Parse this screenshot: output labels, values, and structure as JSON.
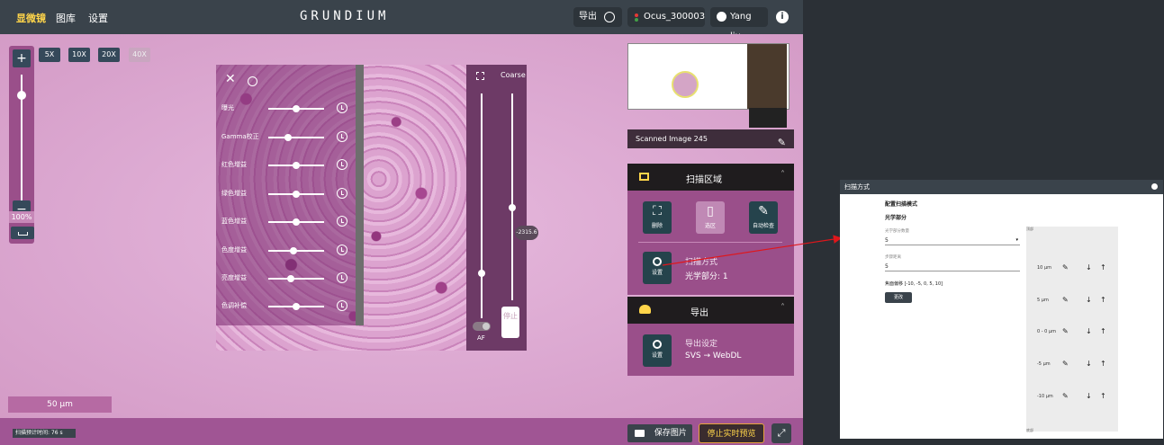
{
  "topbar": {
    "menu": [
      "显微镜",
      "图库",
      "设置"
    ],
    "brand": "GRUNDIUM",
    "export_label": "导出",
    "device_label": "Ocus_300003",
    "user_label": "Yang liu",
    "info_label": "i"
  },
  "zoom": {
    "plus": "+",
    "minus": "−",
    "percent": "100%",
    "level": 0.85
  },
  "magnifications": [
    {
      "label": "5X",
      "active": true
    },
    {
      "label": "10X",
      "active": true
    },
    {
      "label": "20X",
      "active": true
    },
    {
      "label": "40X",
      "active": false
    }
  ],
  "adjustments": {
    "close": "✕",
    "items": [
      {
        "label": "曝光",
        "value": 0.5
      },
      {
        "label": "Gamma校正",
        "value": 0.35
      },
      {
        "label": "红色增益",
        "value": 0.5
      },
      {
        "label": "绿色增益",
        "value": 0.5
      },
      {
        "label": "蓝色增益",
        "value": 0.5
      },
      {
        "label": "色度增益",
        "value": 0.45
      },
      {
        "label": "亮度增益",
        "value": 0.4
      },
      {
        "label": "色调补偿",
        "value": 0.5
      }
    ]
  },
  "focus": {
    "mode": "Coarse",
    "value": "-2315.6",
    "fine_level": 0.2,
    "coarse_level": 0.45,
    "stop_label": "停止",
    "af_label": "AF"
  },
  "slide": {
    "name": "Scanned Image 245"
  },
  "scan_area": {
    "title": "扫描区域",
    "buttons": [
      {
        "label": "删除",
        "icon": "⛶"
      },
      {
        "label": "选区",
        "icon": "▯"
      },
      {
        "label": "自动检查",
        "icon": "✎"
      }
    ],
    "settings_label": "设置",
    "mode_title": "扫描方式",
    "mode_value": "光学部分: 1"
  },
  "export": {
    "title": "导出",
    "settings_label": "设置",
    "info_title": "导出设定",
    "info_value": "SVS → WebDL"
  },
  "footer": {
    "scale": "50 µm",
    "scan_time": "扫描预计时间: 76 s",
    "save_image": "保存图片",
    "stop_live": "停止实时预览",
    "fullscreen": "⤢"
  },
  "dialog": {
    "title": "扫描方式",
    "heading": "配置扫描模式",
    "subheading": "光学部分",
    "field1_label": "光学部分数量",
    "field1_value": "5",
    "field2_label": "步骤距离",
    "field2_value": "5",
    "offset_label": "焦面偏移 [-10, -5, 0, 5, 10]",
    "apply": "更改",
    "top_label": "顶部",
    "bottom_label": "底部",
    "layers": [
      {
        "label": "10 µm"
      },
      {
        "label": "5 µm"
      },
      {
        "label": "0 - 0 µm"
      },
      {
        "label": "-5 µm"
      },
      {
        "label": "-10 µm"
      }
    ]
  },
  "colors": {
    "accent": "#9a4f8a",
    "topbar": "#3a434b",
    "stop_live_border": "#e8a33c",
    "connector": "#e0161b"
  }
}
